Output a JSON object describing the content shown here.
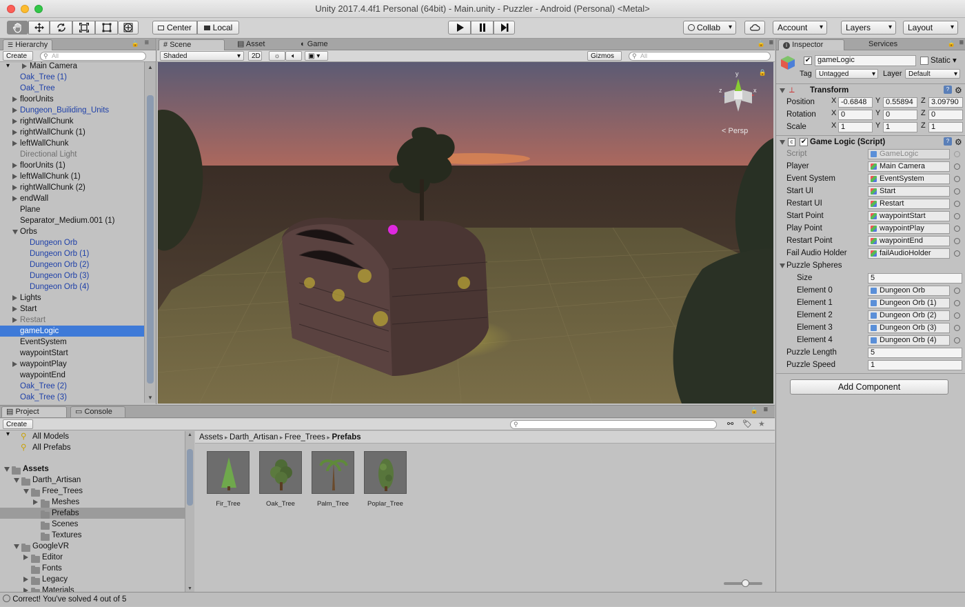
{
  "window": {
    "title": "Unity 2017.4.4f1 Personal (64bit) - Main.unity - Puzzler - Android (Personal) <Metal>"
  },
  "toolbar": {
    "pivot": "Center",
    "space": "Local",
    "collab": "Collab",
    "account": "Account",
    "layers": "Layers",
    "layout": "Layout"
  },
  "hierarchy": {
    "tab": "Hierarchy",
    "create": "Create",
    "search_placeholder": "All",
    "items": [
      {
        "label": "Main Camera",
        "indent": 1,
        "arrow": "right",
        "style": "normal"
      },
      {
        "label": "Oak_Tree (1)",
        "indent": 0,
        "arrow": "none",
        "style": "prefab"
      },
      {
        "label": "Oak_Tree",
        "indent": 0,
        "arrow": "none",
        "style": "prefab"
      },
      {
        "label": "floorUnits",
        "indent": 0,
        "arrow": "right",
        "style": "normal"
      },
      {
        "label": "Dungeon_Builiding_Units",
        "indent": 0,
        "arrow": "right",
        "style": "prefab"
      },
      {
        "label": "rightWallChunk",
        "indent": 0,
        "arrow": "right",
        "style": "normal"
      },
      {
        "label": "rightWallChunk (1)",
        "indent": 0,
        "arrow": "right",
        "style": "normal"
      },
      {
        "label": "leftWallChunk",
        "indent": 0,
        "arrow": "right",
        "style": "normal"
      },
      {
        "label": "Directional Light",
        "indent": 0,
        "arrow": "none",
        "style": "dim"
      },
      {
        "label": "floorUnits (1)",
        "indent": 0,
        "arrow": "right",
        "style": "normal"
      },
      {
        "label": "leftWallChunk (1)",
        "indent": 0,
        "arrow": "right",
        "style": "normal"
      },
      {
        "label": "rightWallChunk (2)",
        "indent": 0,
        "arrow": "right",
        "style": "normal"
      },
      {
        "label": "endWall",
        "indent": 0,
        "arrow": "right",
        "style": "normal"
      },
      {
        "label": "Plane",
        "indent": 0,
        "arrow": "none",
        "style": "normal"
      },
      {
        "label": "Separator_Medium.001 (1)",
        "indent": 0,
        "arrow": "none",
        "style": "normal"
      },
      {
        "label": "Orbs",
        "indent": 0,
        "arrow": "down",
        "style": "normal"
      },
      {
        "label": "Dungeon Orb",
        "indent": 1,
        "arrow": "none",
        "style": "prefab"
      },
      {
        "label": "Dungeon Orb (1)",
        "indent": 1,
        "arrow": "none",
        "style": "prefab"
      },
      {
        "label": "Dungeon Orb (2)",
        "indent": 1,
        "arrow": "none",
        "style": "prefab"
      },
      {
        "label": "Dungeon Orb (3)",
        "indent": 1,
        "arrow": "none",
        "style": "prefab"
      },
      {
        "label": "Dungeon Orb (4)",
        "indent": 1,
        "arrow": "none",
        "style": "prefab"
      },
      {
        "label": "Lights",
        "indent": 0,
        "arrow": "right",
        "style": "normal"
      },
      {
        "label": "Start",
        "indent": 0,
        "arrow": "right",
        "style": "normal"
      },
      {
        "label": "Restart",
        "indent": 0,
        "arrow": "right",
        "style": "dim"
      },
      {
        "label": "gameLogic",
        "indent": 0,
        "arrow": "none",
        "style": "selected"
      },
      {
        "label": "EventSystem",
        "indent": 0,
        "arrow": "none",
        "style": "normal"
      },
      {
        "label": "waypointStart",
        "indent": 0,
        "arrow": "none",
        "style": "normal"
      },
      {
        "label": "waypointPlay",
        "indent": 0,
        "arrow": "right",
        "style": "normal"
      },
      {
        "label": "waypointEnd",
        "indent": 0,
        "arrow": "none",
        "style": "normal"
      },
      {
        "label": "Oak_Tree (2)",
        "indent": 0,
        "arrow": "none",
        "style": "prefab"
      },
      {
        "label": "Oak_Tree (3)",
        "indent": 0,
        "arrow": "none",
        "style": "prefab"
      }
    ]
  },
  "scene": {
    "tabs": [
      "Scene",
      "Asset Store",
      "Game"
    ],
    "shading": "Shaded",
    "mode2d": "2D",
    "gizmos": "Gizmos",
    "search_placeholder": "All",
    "persp": "Persp"
  },
  "inspector": {
    "tabs": [
      "Inspector",
      "Services"
    ],
    "object_name": "gameLogic",
    "static_label": "Static",
    "tag_label": "Tag",
    "tag_value": "Untagged",
    "layer_label": "Layer",
    "layer_value": "Default",
    "transform": {
      "title": "Transform",
      "position_label": "Position",
      "rotation_label": "Rotation",
      "scale_label": "Scale",
      "axis_x": "X",
      "axis_y": "Y",
      "axis_z": "Z",
      "position": [
        "-0.6848",
        "0.55894",
        "3.09790"
      ],
      "rotation": [
        "0",
        "0",
        "0"
      ],
      "scale": [
        "1",
        "1",
        "1"
      ]
    },
    "script": {
      "title": "Game Logic (Script)",
      "script_label": "Script",
      "script_value": "GameLogic",
      "fields": [
        {
          "label": "Player",
          "value": "Main Camera"
        },
        {
          "label": "Event System",
          "value": "EventSystem"
        },
        {
          "label": "Start UI",
          "value": "Start"
        },
        {
          "label": "Restart UI",
          "value": "Restart"
        },
        {
          "label": "Start Point",
          "value": "waypointStart"
        },
        {
          "label": "Play Point",
          "value": "waypointPlay"
        },
        {
          "label": "Restart Point",
          "value": "waypointEnd"
        },
        {
          "label": "Fail Audio Holder",
          "value": "failAudioHolder"
        }
      ],
      "spheres_label": "Puzzle Spheres",
      "size_label": "Size",
      "size_value": "5",
      "elements": [
        {
          "label": "Element 0",
          "value": "Dungeon Orb"
        },
        {
          "label": "Element 1",
          "value": "Dungeon Orb (1)"
        },
        {
          "label": "Element 2",
          "value": "Dungeon Orb (2)"
        },
        {
          "label": "Element 3",
          "value": "Dungeon Orb (3)"
        },
        {
          "label": "Element 4",
          "value": "Dungeon Orb (4)"
        }
      ],
      "length_label": "Puzzle Length",
      "length_value": "5",
      "speed_label": "Puzzle Speed",
      "speed_value": "1"
    },
    "add_component": "Add Component"
  },
  "project": {
    "tabs": [
      "Project",
      "Console"
    ],
    "create": "Create",
    "favorites": [
      "All Models",
      "All Prefabs"
    ],
    "tree": [
      {
        "label": "Assets",
        "indent": 0,
        "arrow": "down",
        "bold": true
      },
      {
        "label": "Darth_Artisan",
        "indent": 1,
        "arrow": "down",
        "bold": false
      },
      {
        "label": "Free_Trees",
        "indent": 2,
        "arrow": "down",
        "bold": false
      },
      {
        "label": "Meshes",
        "indent": 3,
        "arrow": "right",
        "bold": false
      },
      {
        "label": "Prefabs",
        "indent": 3,
        "arrow": "none",
        "bold": false
      },
      {
        "label": "Scenes",
        "indent": 3,
        "arrow": "none",
        "bold": false
      },
      {
        "label": "Textures",
        "indent": 3,
        "arrow": "none",
        "bold": false
      },
      {
        "label": "GoogleVR",
        "indent": 1,
        "arrow": "down",
        "bold": false
      },
      {
        "label": "Editor",
        "indent": 2,
        "arrow": "right",
        "bold": false
      },
      {
        "label": "Fonts",
        "indent": 2,
        "arrow": "none",
        "bold": false
      },
      {
        "label": "Legacy",
        "indent": 2,
        "arrow": "right",
        "bold": false
      },
      {
        "label": "Materials",
        "indent": 2,
        "arrow": "right",
        "bold": false
      }
    ],
    "breadcrumb": [
      "Assets",
      "Darth_Artisan",
      "Free_Trees",
      "Prefabs"
    ],
    "assets": [
      "Fir_Tree",
      "Oak_Tree",
      "Palm_Tree",
      "Poplar_Tree"
    ]
  },
  "status": {
    "message": "Correct!  You've solved 4 out of 5"
  }
}
